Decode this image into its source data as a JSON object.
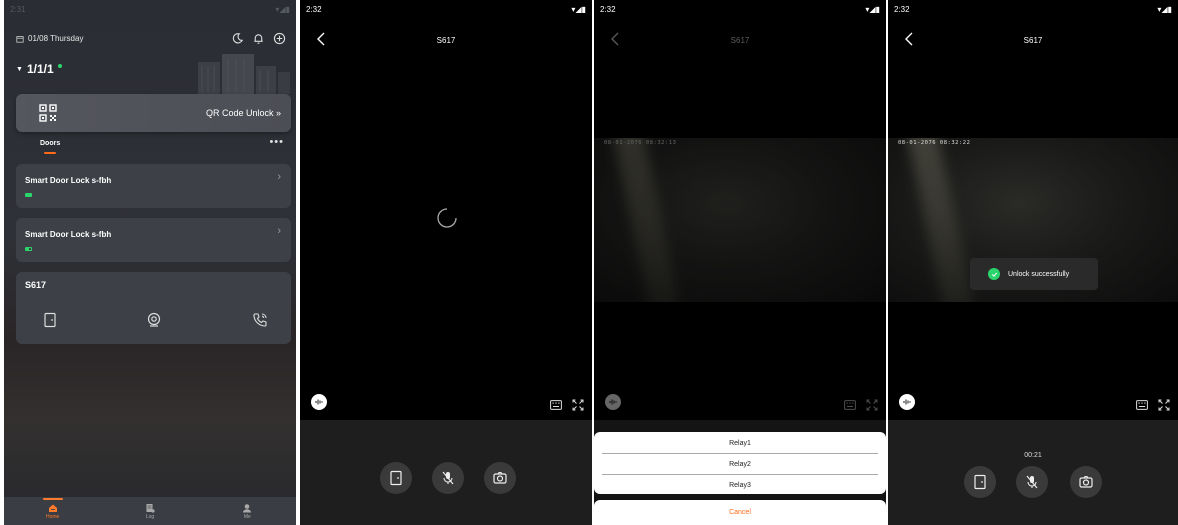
{
  "screen_home": {
    "status_time": "2:31",
    "date": "01/08 Thursday",
    "location": "1/1/1",
    "qr": {
      "label": "QR Code Unlock »"
    },
    "tabs": {
      "doors": "Doors"
    },
    "locks": [
      {
        "name": "Smart Door Lock s-fbh",
        "battery_level": 1.0
      },
      {
        "name": "Smart Door Lock s-fbh",
        "battery_level": 0.5
      }
    ],
    "device": {
      "name": "S617"
    },
    "nav": [
      {
        "label": "Home",
        "icon": "home-icon",
        "active": true
      },
      {
        "label": "Log",
        "icon": "log-icon",
        "active": false
      },
      {
        "label": "Me",
        "icon": "me-icon",
        "active": false
      }
    ]
  },
  "screen_connecting": {
    "status_time": "2:32",
    "title": "S617"
  },
  "screen_relay": {
    "status_time": "2:32",
    "title": "S617",
    "timestamp": "08-01-2076 08:32:13",
    "relays": [
      "Relay1",
      "Relay2",
      "Relay3"
    ],
    "cancel": "Cancel"
  },
  "screen_unlocked": {
    "status_time": "2:32",
    "title": "S617",
    "timestamp": "08-01-2076 08:32:22",
    "toast": "Unlock successfully",
    "timer": "00:21"
  },
  "colors": {
    "accent": "#ff6a1a",
    "success": "#2bd56b",
    "card": "#3d4046"
  }
}
